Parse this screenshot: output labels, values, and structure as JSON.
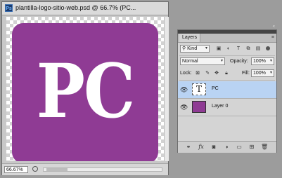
{
  "document": {
    "title": "plantilla-logo-sitio-web.psd @ 66.7% (PC...",
    "ps_icon": "Ps",
    "logo_text": "PC",
    "logo_color": "#8f3b94",
    "zoom": "66.67%"
  },
  "layers_panel": {
    "tab_label": "Layers",
    "kind_label": "Kind",
    "blend_mode": "Normal",
    "opacity_label": "Opacity:",
    "opacity_value": "100%",
    "lock_label": "Lock:",
    "fill_label": "Fill:",
    "fill_value": "100%",
    "layers": [
      {
        "name": "PC",
        "type": "text",
        "thumb": "T",
        "selected": true
      },
      {
        "name": "Layer 0",
        "type": "image",
        "selected": false
      }
    ],
    "bottom_icons": [
      "link-icon",
      "fx-icon",
      "mask-icon",
      "adjustment-icon",
      "folder-icon",
      "new-layer-icon",
      "trash-icon"
    ],
    "bottom_fx": "fx",
    "selected_row_color": "#b9d3f3"
  }
}
